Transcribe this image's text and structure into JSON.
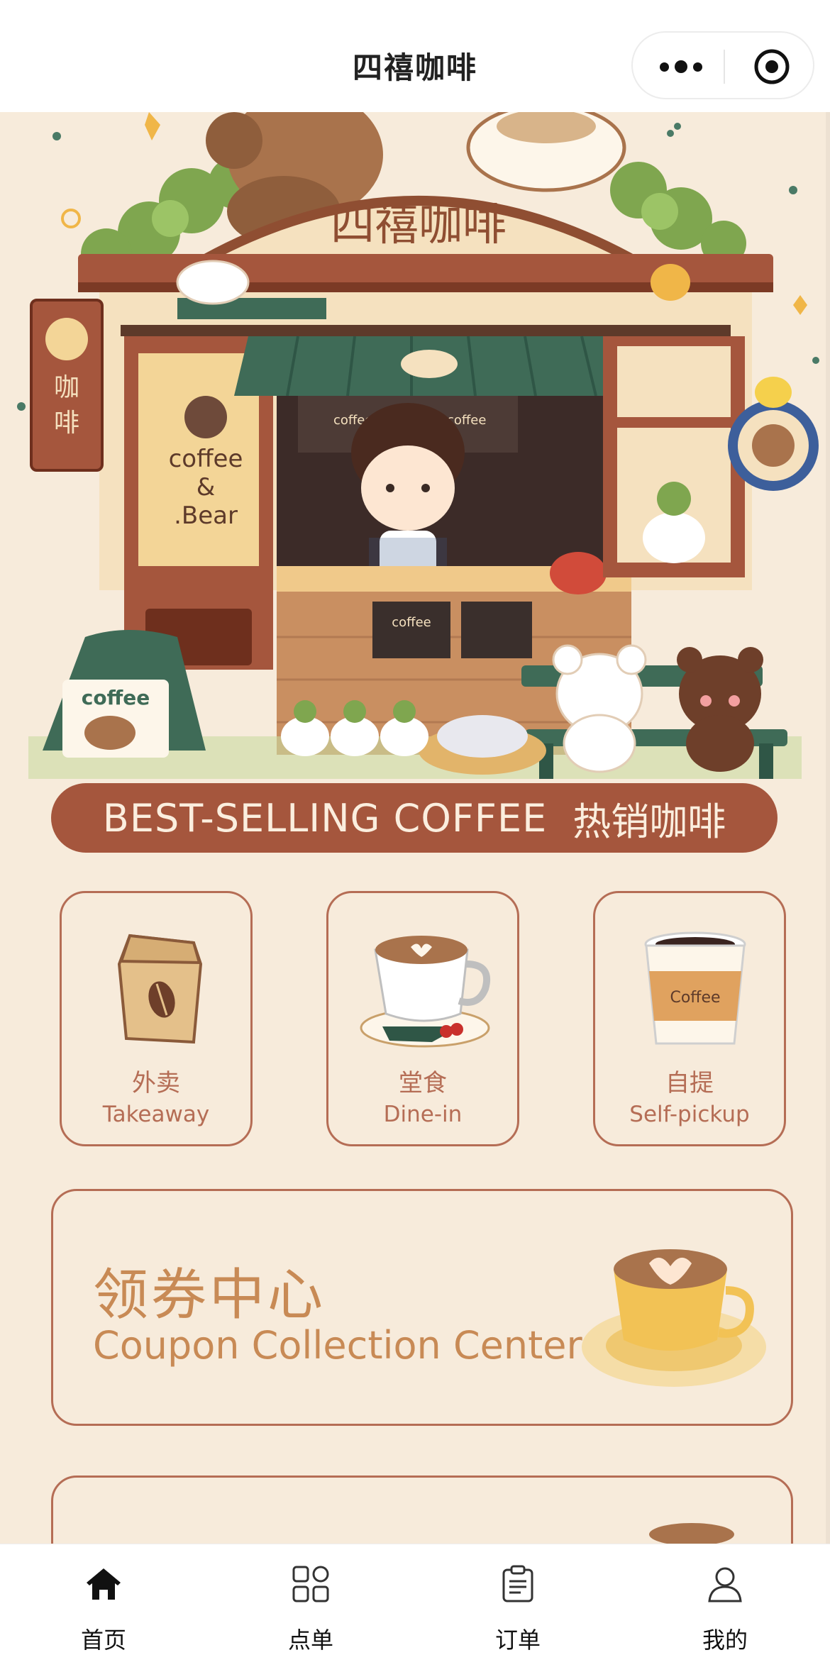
{
  "navbar": {
    "title": "四禧咖啡"
  },
  "hero": {
    "sign_text": "四禧咖啡",
    "side_sign": "咖啡",
    "shop_window": "coffee & Bear",
    "aframe_sign": "coffee",
    "menu_board_left": "coffee",
    "menu_board_right": "coffee",
    "chalk_board": "coffee",
    "cup_label": "Coffee"
  },
  "banner": {
    "en": "BEST-SELLING COFFEE",
    "cn": "热销咖啡"
  },
  "services": [
    {
      "cn": "外卖",
      "en": "Takeaway"
    },
    {
      "cn": "堂食",
      "en": "Dine-in"
    },
    {
      "cn": "自提",
      "en": "Self-pickup"
    }
  ],
  "coupon": {
    "cn": "领券中心",
    "en": "Coupon Collection Center"
  },
  "tabbar": {
    "items": [
      {
        "label": "首页",
        "icon": "home-icon"
      },
      {
        "label": "点单",
        "icon": "grid-icon"
      },
      {
        "label": "订单",
        "icon": "clipboard-icon"
      },
      {
        "label": "我的",
        "icon": "person-icon"
      }
    ]
  },
  "colors": {
    "background": "#f7ebdb",
    "accent": "#a5563d",
    "card_border": "#b56d55",
    "coupon_text": "#c88a55"
  }
}
